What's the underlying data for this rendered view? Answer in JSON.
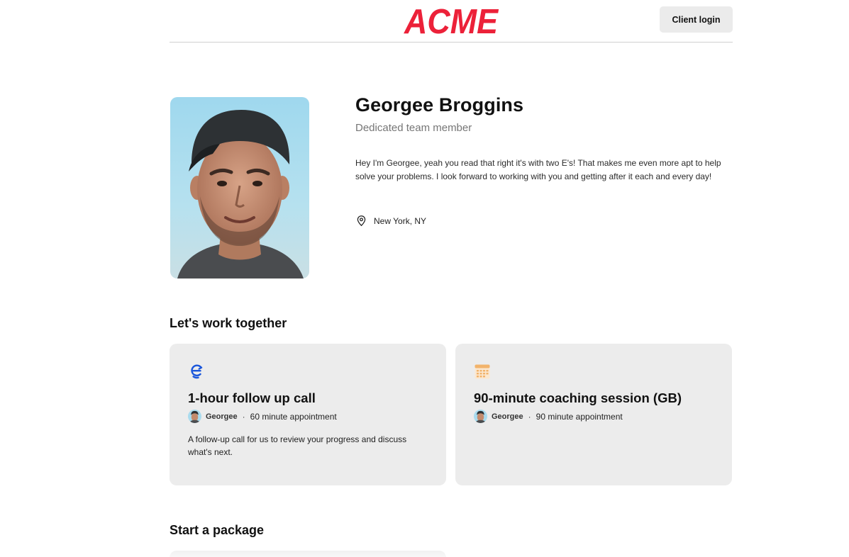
{
  "brand": {
    "logo_text": "ACME",
    "logo_color": "#EC2139"
  },
  "header": {
    "client_login_label": "Client login"
  },
  "profile": {
    "name": "Georgee Broggins",
    "role": "Dedicated team member",
    "bio": "Hey I'm Georgee, yeah you read that right it's with two E's! That makes me even more apt to help solve your problems. I look forward to working with you and getting after it each and every day!",
    "location": "New York, NY",
    "location_icon": "map-pin-icon",
    "photo": "profile-photo"
  },
  "sections": {
    "work_together": "Let's work together",
    "package": "Start a package"
  },
  "services": [
    {
      "icon": "calendly-logo-icon",
      "title": "1-hour follow up call",
      "host": "Georgee",
      "duration": "60 minute appointment",
      "description": "A follow-up call for us to review your progress and discuss what's next."
    },
    {
      "icon": "calendar-icon",
      "title": "90-minute coaching session (GB)",
      "host": "Georgee",
      "duration": "90 minute appointment",
      "description": ""
    }
  ],
  "colors": {
    "card_background": "#ECECEC",
    "button_background": "#EBEBEB",
    "muted_text": "#767676",
    "icon_blue": "#1A56DB",
    "calendar_orange": "#F2B36B"
  }
}
